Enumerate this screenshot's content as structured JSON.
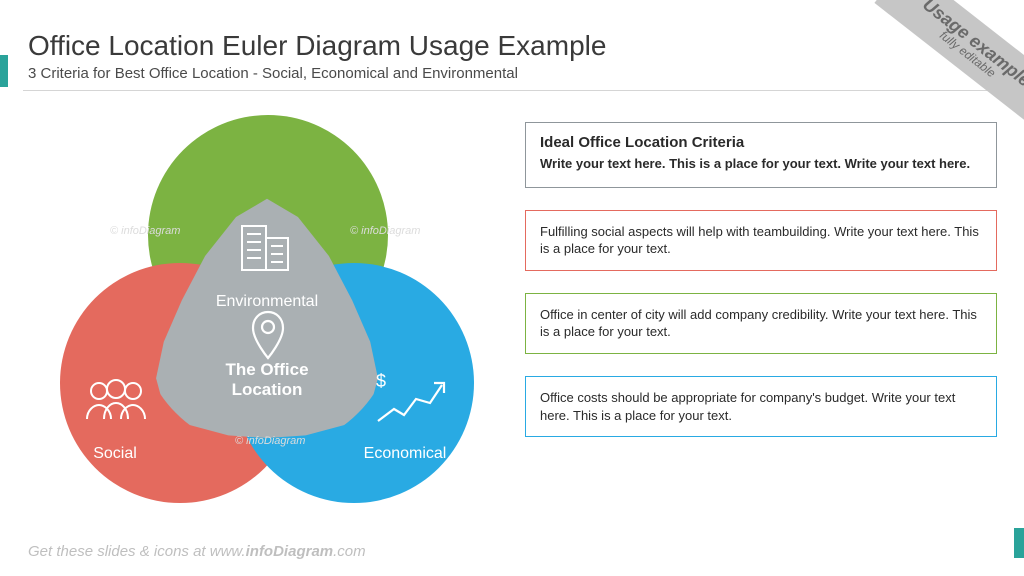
{
  "header": {
    "title": "Office Location Euler Diagram Usage Example",
    "subtitle": "3 Criteria for Best Office Location - Social, Economical and Environmental"
  },
  "ribbon": {
    "line1": "Usage example",
    "line2": "fully editable"
  },
  "diagram": {
    "top": {
      "label": "Environmental",
      "icon": "building-icon"
    },
    "left": {
      "label": "Social",
      "icon": "people-icon"
    },
    "right": {
      "label": "Economical",
      "icon": "growth-chart-icon"
    },
    "center": {
      "label": "The Office Location",
      "icon": "pin-icon"
    }
  },
  "boxes": {
    "main": {
      "title": "Ideal Office Location Criteria",
      "sub": "Write your text here. This is a place for your text. Write your text here."
    },
    "social": "Fulfilling social aspects will help with teambuilding. Write your text here. This is a place for your text.",
    "environment": "Office in center of city will add company credibility. Write your text here. This is a place for your text.",
    "economical": "Office costs should be appropriate for company's budget. Write your text here. This is a place for your text."
  },
  "footer": {
    "pre": "Get these slides & icons at www.",
    "brand": "infoDiagram",
    "post": ".com"
  },
  "watermark": "© infoDiagram"
}
